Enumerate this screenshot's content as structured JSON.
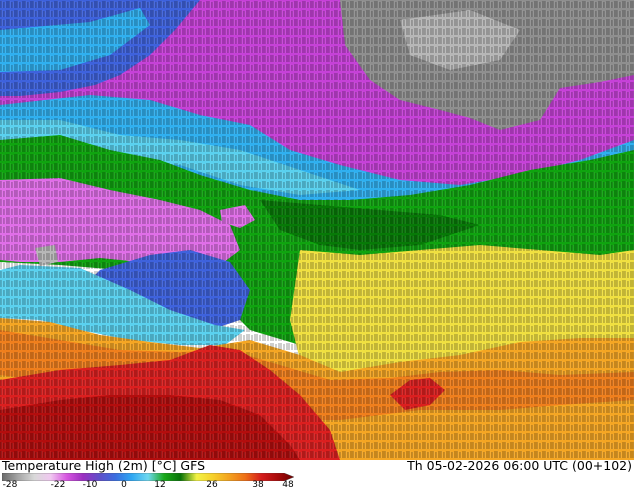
{
  "title": {
    "left": "Temperature High (2m) [°C] GFS",
    "right": "Th 05-02-2026 06:00 UTC (00+102)"
  },
  "colorbar": {
    "ticks": [
      "-28",
      "-22",
      "-10",
      "0",
      "12",
      "26",
      "38",
      "48"
    ],
    "stops": [
      "#6a6a6a",
      "#a6a6a6",
      "#d9d9d9",
      "#f0c8f0",
      "#d655e0",
      "#9a2fc0",
      "#5f4fc9",
      "#3b6ee0",
      "#2fa7f2",
      "#6fd8f0",
      "#19a919",
      "#077207",
      "#f2f244",
      "#f6d02a",
      "#f3a21f",
      "#ee6f17",
      "#d41c1c",
      "#a80a0a",
      "#6b0000"
    ]
  },
  "map": {
    "colors": {
      "grey_land": "#8f8f8f",
      "light_grey": "#b7b7b7",
      "magenta": "#c641d8",
      "light_magenta": "#e06ee8",
      "blue": "#3e62dd",
      "light_blue": "#2fb0f0",
      "cyan": "#5ad1ef",
      "green": "#0fa40f",
      "dark_green": "#077a07",
      "yellow": "#f0e040",
      "orange": "#f5a623",
      "deep_orange": "#f07f1c",
      "red": "#dc1f1f",
      "dark_red": "#b40d0d"
    }
  }
}
